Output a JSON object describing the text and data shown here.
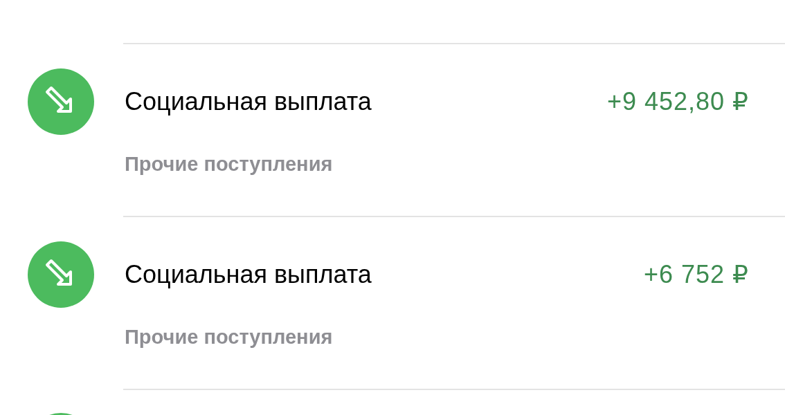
{
  "transactions": [
    {
      "title": "Социальная выплата",
      "amount": "+9 452,80 ₽",
      "category": "Прочие поступления",
      "incoming": true
    },
    {
      "title": "Социальная выплата",
      "amount": "+6 752 ₽",
      "category": "Прочие поступления",
      "incoming": true
    }
  ]
}
